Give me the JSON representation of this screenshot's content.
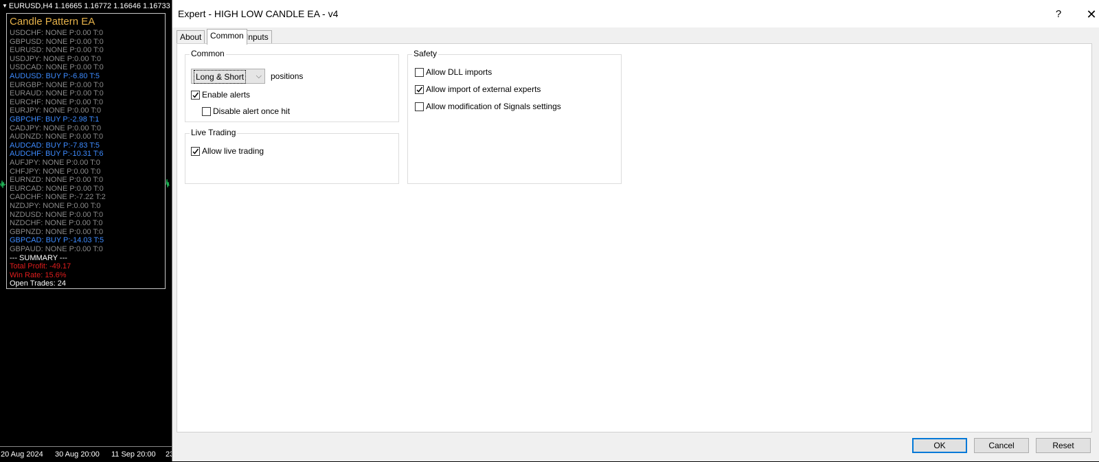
{
  "chart": {
    "header": "EURUSD,H4  1.16665 1.16772 1.16646 1.16733",
    "panel_title": "Candle Pattern EA",
    "rows": [
      {
        "text": "USDCHF: NONE P:0.00 T:0",
        "kind": "none"
      },
      {
        "text": "GBPUSD: NONE P:0.00 T:0",
        "kind": "none"
      },
      {
        "text": "EURUSD: NONE P:0.00 T:0",
        "kind": "none"
      },
      {
        "text": "USDJPY: NONE P:0.00 T:0",
        "kind": "none"
      },
      {
        "text": "USDCAD: NONE P:0.00 T:0",
        "kind": "none"
      },
      {
        "text": "AUDUSD: BUY P:-6.80 T:5",
        "kind": "buy"
      },
      {
        "text": "EURGBP: NONE P:0.00 T:0",
        "kind": "none"
      },
      {
        "text": "EURAUD: NONE P:0.00 T:0",
        "kind": "none"
      },
      {
        "text": "EURCHF: NONE P:0.00 T:0",
        "kind": "none"
      },
      {
        "text": "EURJPY: NONE P:0.00 T:0",
        "kind": "none"
      },
      {
        "text": "GBPCHF: BUY P:-2.98 T:1",
        "kind": "buy"
      },
      {
        "text": "CADJPY: NONE P:0.00 T:0",
        "kind": "none"
      },
      {
        "text": "AUDNZD: NONE P:0.00 T:0",
        "kind": "none"
      },
      {
        "text": "AUDCAD: BUY P:-7.83 T:5",
        "kind": "buy"
      },
      {
        "text": "AUDCHF: BUY P:-10.31 T:6",
        "kind": "buy"
      },
      {
        "text": "AUFJPY: NONE P:0.00 T:0",
        "kind": "none"
      },
      {
        "text": "CHFJPY: NONE P:0.00 T:0",
        "kind": "none"
      },
      {
        "text": "EURNZD: NONE P:0.00 T:0",
        "kind": "none"
      },
      {
        "text": "EURCAD: NONE P:0.00 T:0",
        "kind": "none"
      },
      {
        "text": "CADCHF: NONE P:-7.22 T:2",
        "kind": "none"
      },
      {
        "text": "NZDJPY: NONE P:0.00 T:0",
        "kind": "none"
      },
      {
        "text": "NZDUSD: NONE P:0.00 T:0",
        "kind": "none"
      },
      {
        "text": "NZDCHF: NONE P:0.00 T:0",
        "kind": "none"
      },
      {
        "text": "GBPNZD: NONE P:0.00 T:0",
        "kind": "none"
      },
      {
        "text": "GBPCAD: BUY P:-14.03 T:5",
        "kind": "buy"
      },
      {
        "text": "GBPAUD: NONE P:0.00 T:0",
        "kind": "none"
      },
      {
        "text": "--- SUMMARY ---",
        "kind": "white"
      },
      {
        "text": "Total Profit: -49.17",
        "kind": "red"
      },
      {
        "text": "Win Rate: 15.6%",
        "kind": "red"
      },
      {
        "text": "Open Trades: 24",
        "kind": "white"
      }
    ],
    "time_labels": [
      "20 Aug 2024",
      "30 Aug 20:00",
      "11 Sep 20:00",
      "23"
    ],
    "colors": {
      "none": "#8a8a8a",
      "buy": "#3d8bff",
      "red": "#e11d1d",
      "title": "#e6b24a",
      "price_line": "#22c55e"
    }
  },
  "dialog": {
    "title": "Expert - HIGH LOW CANDLE EA - v4",
    "help": "?",
    "close": "✕",
    "tabs": [
      "About",
      "Common",
      "Inputs"
    ],
    "active_tab": "Common",
    "common": {
      "group_title": "Common",
      "mode_value": "Long & Short",
      "positions_label": "positions",
      "enable_alerts": {
        "label": "Enable alerts",
        "checked": true
      },
      "disable_alert_once_hit": {
        "label": "Disable alert once hit",
        "checked": false
      }
    },
    "live": {
      "group_title": "Live Trading",
      "allow_live_trading": {
        "label": "Allow live trading",
        "checked": true
      }
    },
    "safety": {
      "group_title": "Safety",
      "allow_dll": {
        "label": "Allow DLL imports",
        "checked": false
      },
      "allow_import_experts": {
        "label": "Allow import of external experts",
        "checked": true
      },
      "allow_signals": {
        "label": "Allow modification of Signals settings",
        "checked": false
      }
    },
    "buttons": {
      "ok": "OK",
      "cancel": "Cancel",
      "reset": "Reset"
    }
  }
}
